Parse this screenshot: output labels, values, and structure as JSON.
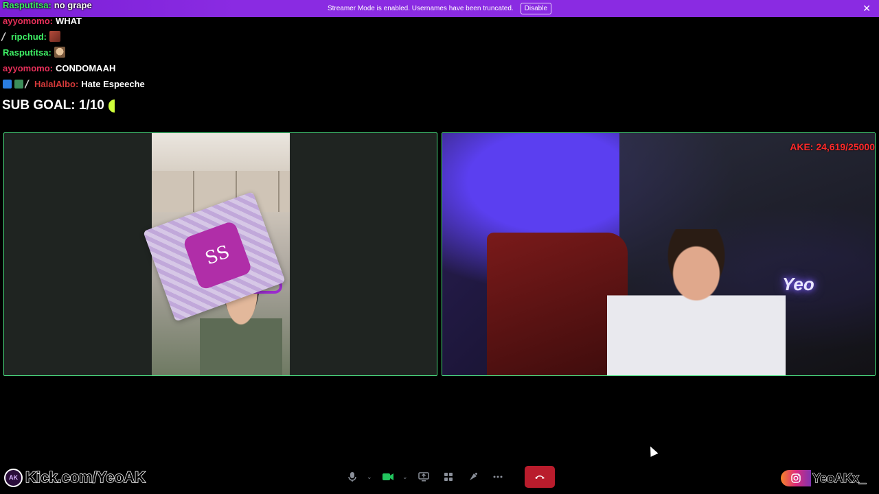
{
  "banner": {
    "message": "Streamer Mode is enabled. Usernames have been truncated.",
    "disable_label": "Disable",
    "close_icon": "close-icon"
  },
  "chat": [
    {
      "user": "Rasputitsa:",
      "color": "green",
      "message": "no grape"
    },
    {
      "user": "ayyomomo:",
      "color": "red",
      "message": "WHAT"
    },
    {
      "user": "ripchud:",
      "color": "green",
      "message": ""
    },
    {
      "user": "Rasputitsa:",
      "color": "green",
      "message": ""
    },
    {
      "user": "ayyomomo:",
      "color": "red",
      "message": "CONDOMAAH"
    },
    {
      "user": "HalalAlbo:",
      "color": "darkred",
      "message": "Hate Espeeche"
    }
  ],
  "sub_goal": "SUB GOAL: 1/10",
  "tiles": {
    "right_overlay": "AKE: 24,619/25000",
    "box_logo": "SS",
    "neon_sign": "Yeo"
  },
  "controls": {
    "mic_icon": "microphone-icon",
    "camera_icon": "camera-icon",
    "screenshare_icon": "screen-share-icon",
    "activities_icon": "activities-icon",
    "soundboard_icon": "soundboard-icon",
    "more_icon": "more-icon",
    "hangup_icon": "hang-up-icon"
  },
  "footer": {
    "kick_logo": "AK",
    "kick": "Kick.com/YeoAK",
    "instagram": "YeoAKx_"
  },
  "colors": {
    "banner": "#8a2be2",
    "tile_border": "#4ade80",
    "hangup": "#b91c2c",
    "goal_red": "#ff2a2a"
  }
}
